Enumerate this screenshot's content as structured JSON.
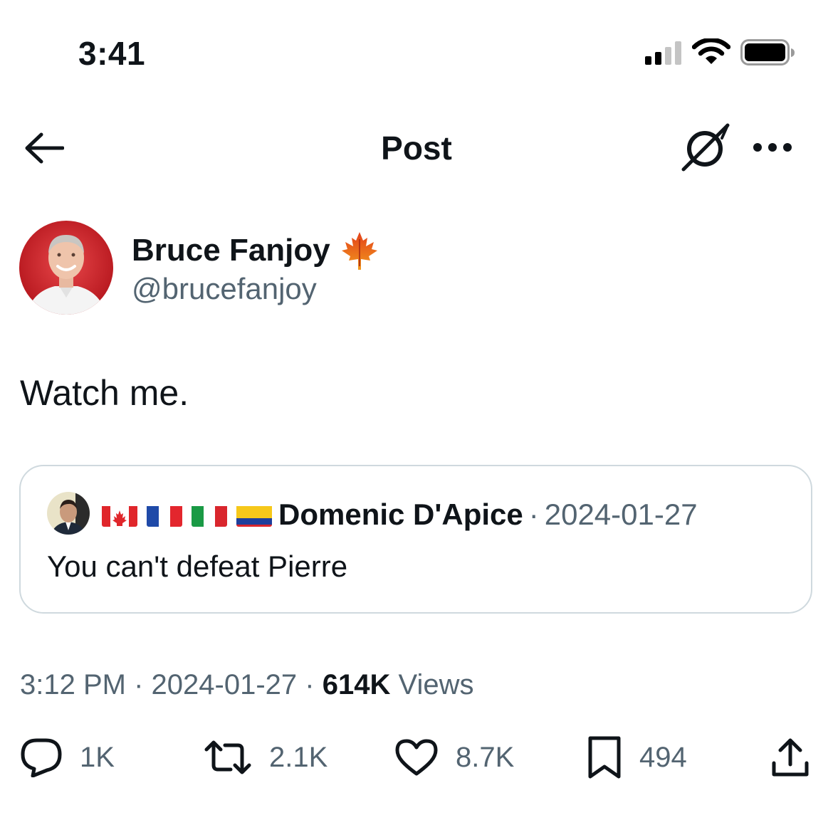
{
  "status_bar": {
    "time": "3:41"
  },
  "header": {
    "title": "Post"
  },
  "post": {
    "author_name": "Bruce Fanjoy",
    "author_handle": "@brucefanjoy",
    "text": "Watch me.",
    "time": "3:12 PM",
    "date": "2024-01-27",
    "views_count": "614K",
    "views_label": "Views"
  },
  "quote": {
    "author_name": "Domenic D'Apice",
    "separator": "·",
    "date": "2024-01-27",
    "text": "You can't defeat Pierre"
  },
  "meta": {
    "separator": "·"
  },
  "actions": {
    "replies": "1K",
    "reposts": "2.1K",
    "likes": "8.7K",
    "bookmarks": "494"
  },
  "colors": {
    "text": "#0f1419",
    "secondary": "#536471",
    "border": "#cfd9de"
  }
}
